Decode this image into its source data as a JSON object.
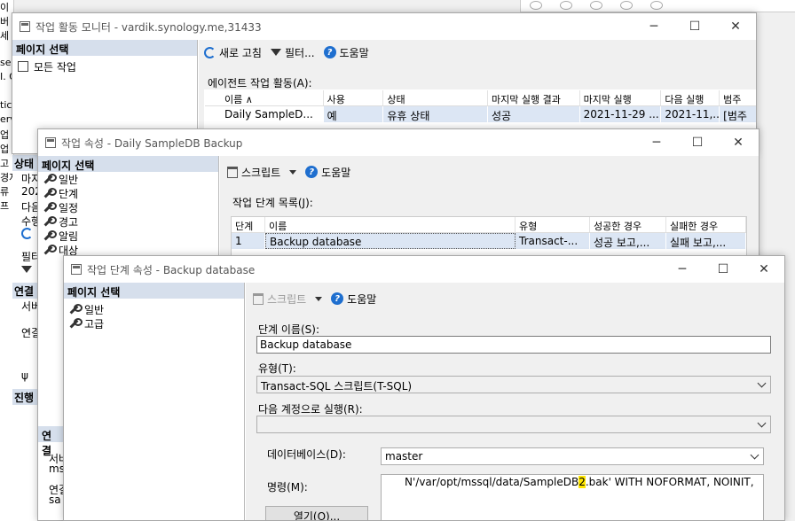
{
  "background": {
    "left_strip": [
      "이",
      "버",
      "세",
      "",
      "se",
      "I. O",
      "",
      "tic",
      "erv",
      "업",
      "업",
      "고",
      "경저",
      "류",
      "프"
    ],
    "panel_header": "상태",
    "panel_items": [
      "마지",
      "202",
      "다음",
      "수행"
    ],
    "panel_labels": [
      "필터",
      "연결",
      "서버",
      "연결",
      "진행"
    ]
  },
  "monitor": {
    "title": "작업 활동 모니터 - vardik.synology.me,31433",
    "left": {
      "header": "페이지 선택",
      "items": [
        "모든 작업"
      ]
    },
    "toolbar": {
      "refresh": "새로 고침",
      "filter": "필터...",
      "help": "도움말"
    },
    "grid_label": "에이전트 작업 활동(A):",
    "columns": [
      "이름 ∧",
      "사용",
      "상태",
      "마지막 실행 결과",
      "마지막 실행",
      "다음 실행",
      "범주"
    ],
    "rows": [
      [
        "Daily SampleD...",
        "예",
        "유휴 상태",
        "성공",
        "2021-11-29 ...",
        "2021-11,...",
        "[범주"
      ]
    ]
  },
  "props": {
    "title": "작업 속성 - Daily SampleDB Backup",
    "left": {
      "header": "페이지 선택",
      "items": [
        "일반",
        "단계",
        "일정",
        "경고",
        "알림",
        "대상"
      ]
    },
    "toolbar": {
      "script": "스크립트",
      "help": "도움말"
    },
    "grid_label": "작업 단계 목록(J):",
    "columns": [
      "단계",
      "이름",
      "유형",
      "성공한 경우",
      "실패한 경우"
    ],
    "rows": [
      [
        "1",
        "Backup database",
        "Transact-...",
        "성공 보고,...",
        "실패 보고,..."
      ]
    ],
    "left_lower": {
      "header": "연결",
      "items": [
        "서버",
        "ms",
        "연결",
        "sa"
      ],
      "progress": "진행"
    }
  },
  "step": {
    "title": "작업 단계 속성 - Backup database",
    "left": {
      "header": "페이지 선택",
      "items": [
        "일반",
        "고급"
      ]
    },
    "toolbar": {
      "script": "스크립트",
      "help": "도움말"
    },
    "step_name_label": "단계 이름(S):",
    "step_name_value": "Backup database",
    "type_label": "유형(T):",
    "type_value": "Transact-SQL 스크립트(T-SQL)",
    "run_as_label": "다음 계정으로 실행(R):",
    "run_as_value": "",
    "db_label": "데이터베이스(D):",
    "db_value": "master",
    "command_label": "명령(M):",
    "command_pre": "N'/var/opt/mssql/data/SampleDB",
    "command_hl": "2",
    "command_post": ".bak' WITH NOFORMAT, NOINIT,",
    "open_button": "열기(O)..."
  },
  "colors": {
    "header_bg": "#d6dfec",
    "selected_row": "#dce6f4",
    "accent": "#1f6fcf",
    "highlight": "#ffe600"
  }
}
